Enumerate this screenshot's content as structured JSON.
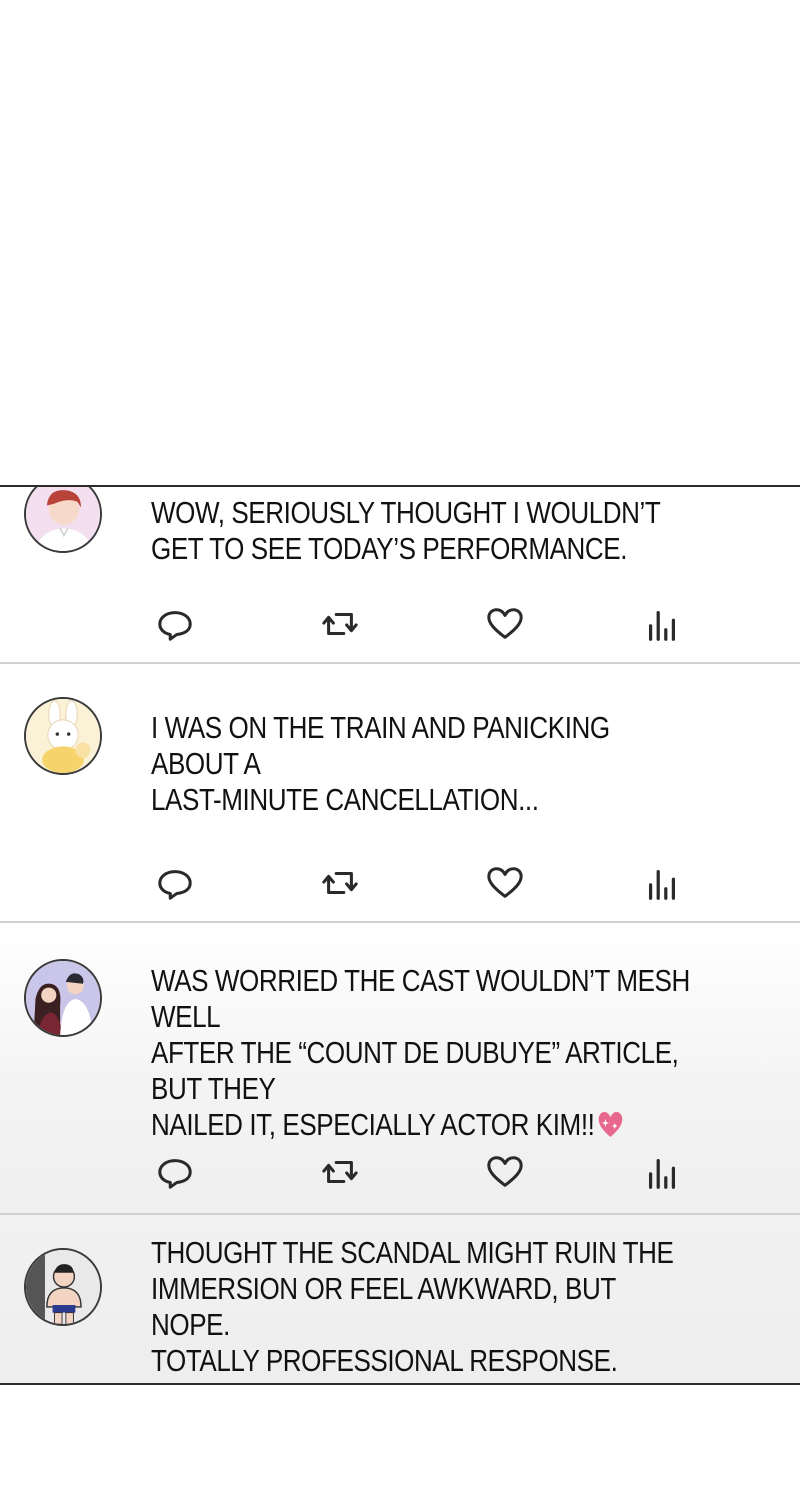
{
  "posts": [
    {
      "text": "WOW, SERIOUSLY THOUGHT I WOULDN’T\nGET TO SEE TODAY’S PERFORMANCE.",
      "avatar": "avatar-man-red-hair"
    },
    {
      "text": "I WAS ON THE TRAIN AND PANICKING ABOUT A\nLAST-MINUTE CANCELLATION...",
      "avatar": "avatar-bunny"
    },
    {
      "text": "WAS WORRIED THE CAST WOULDN’T MESH WELL\nAFTER THE “COUNT DE DUBUYE” ARTICLE, BUT THEY\nNAILED IT, ESPECIALLY ACTOR KIM!!",
      "avatar": "avatar-couple",
      "emoji": "sparkling-heart-icon"
    },
    {
      "text": "THOUGHT THE SCANDAL MIGHT RUIN THE\nIMMERSION OR FEEL AWKWARD, BUT NOPE.\nTOTALLY PROFESSIONAL RESPONSE.",
      "avatar": "avatar-muscle-man"
    }
  ],
  "actions": [
    "reply-icon",
    "retweet-icon",
    "like-icon",
    "views-icon"
  ],
  "colors": {
    "divider": "#cfcfcf",
    "border": "#2b2b2b",
    "icon": "#2a2a2a",
    "heart": "#e8678f"
  }
}
